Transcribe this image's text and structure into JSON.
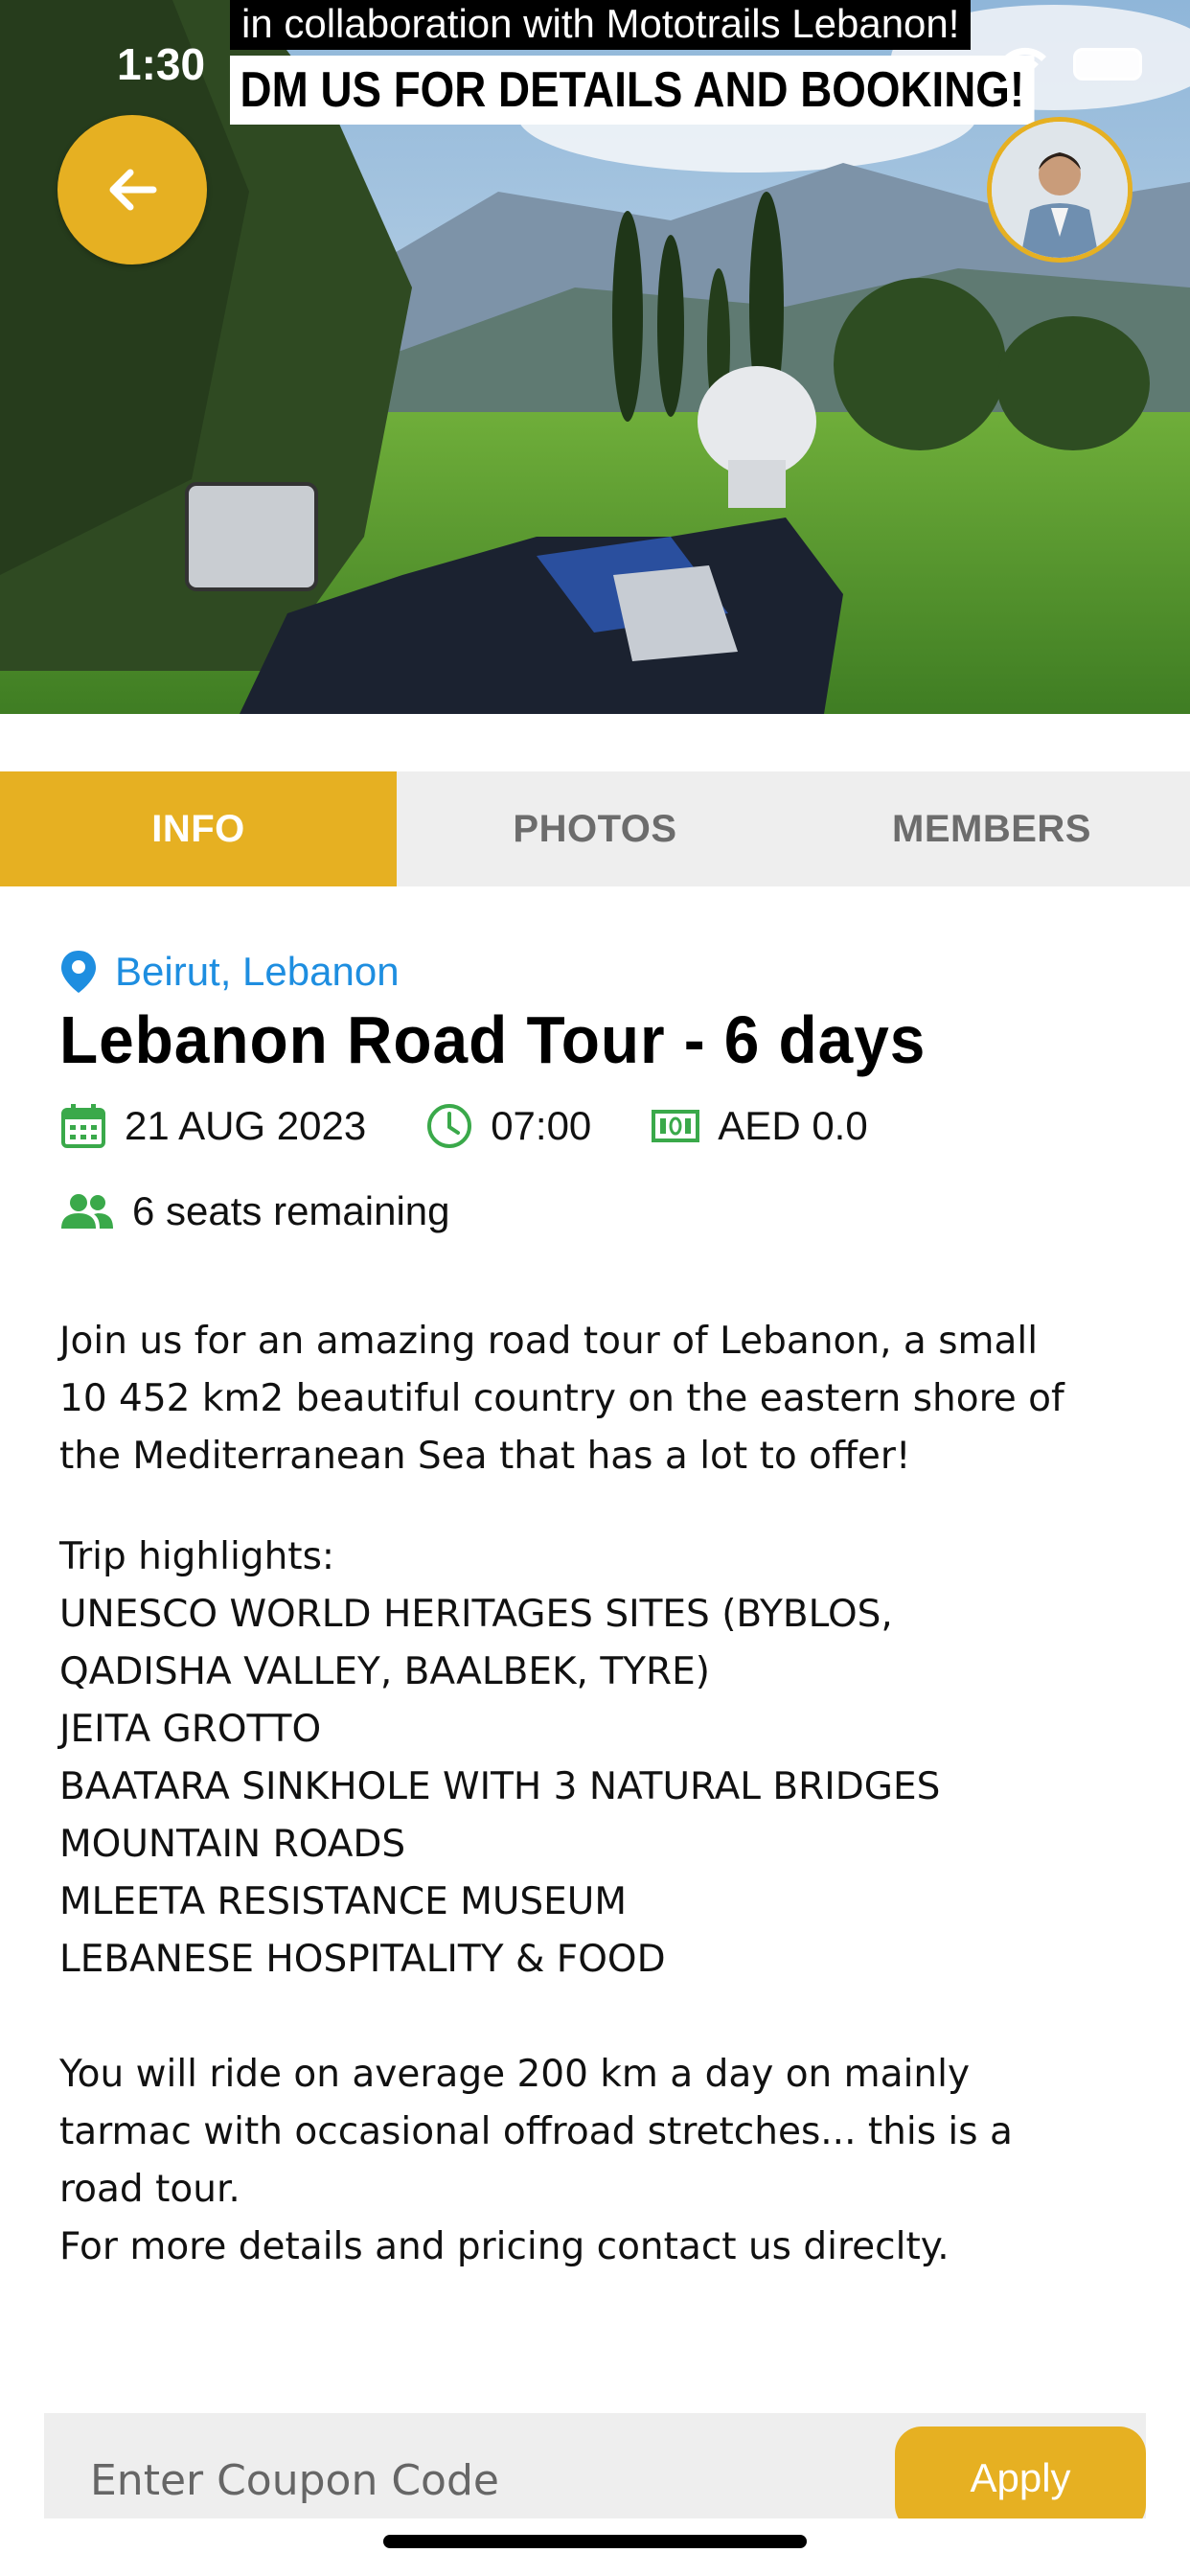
{
  "status_bar": {
    "time": "1:30"
  },
  "hero": {
    "banner_line_1": "in collaboration with Mototrails Lebanon!",
    "banner_line_2": "DM US FOR DETAILS AND BOOKING!"
  },
  "tabs": [
    {
      "label": "INFO",
      "active": true
    },
    {
      "label": "PHOTOS",
      "active": false
    },
    {
      "label": "MEMBERS",
      "active": false
    }
  ],
  "event": {
    "location": "Beirut, Lebanon",
    "title": "Lebanon Road Tour - 6 days",
    "date": "21 AUG 2023",
    "time": "07:00",
    "price": "AED 0.0",
    "seats": "6 seats remaining"
  },
  "description": {
    "intro": "Join us for an amazing road tour of Lebanon, a small\n10 452 km2 beautiful country on the eastern shore of\nthe Mediterranean Sea that has a lot to offer!",
    "highlights": "Trip highlights:\nUNESCO WORLD HERITAGES SITES (BYBLOS,\nQADISHA VALLEY, BAALBEK, TYRE)\nJEITA GROTTO\nBAATARA SINKHOLE WITH 3 NATURAL BRIDGES\nMOUNTAIN ROADS\nMLEETA RESISTANCE MUSEUM\nLEBANESE HOSPITALITY & FOOD",
    "outro": "You will ride on average 200 km a day on mainly\ntarmac with occasional offroad stretches... this is a\nroad tour.\nFor more details and pricing contact us direclty."
  },
  "coupon": {
    "placeholder": "Enter Coupon Code",
    "apply_label": "Apply"
  },
  "colors": {
    "accent": "#e6b022",
    "location_blue": "#1e8ee0",
    "icon_green": "#3aa94a",
    "tab_inactive_bg": "#eeeeee"
  },
  "icons": {
    "back": "arrow-left-icon",
    "location": "map-pin-icon",
    "date": "calendar-icon",
    "time": "clock-icon",
    "price": "money-icon",
    "seats": "people-icon"
  }
}
